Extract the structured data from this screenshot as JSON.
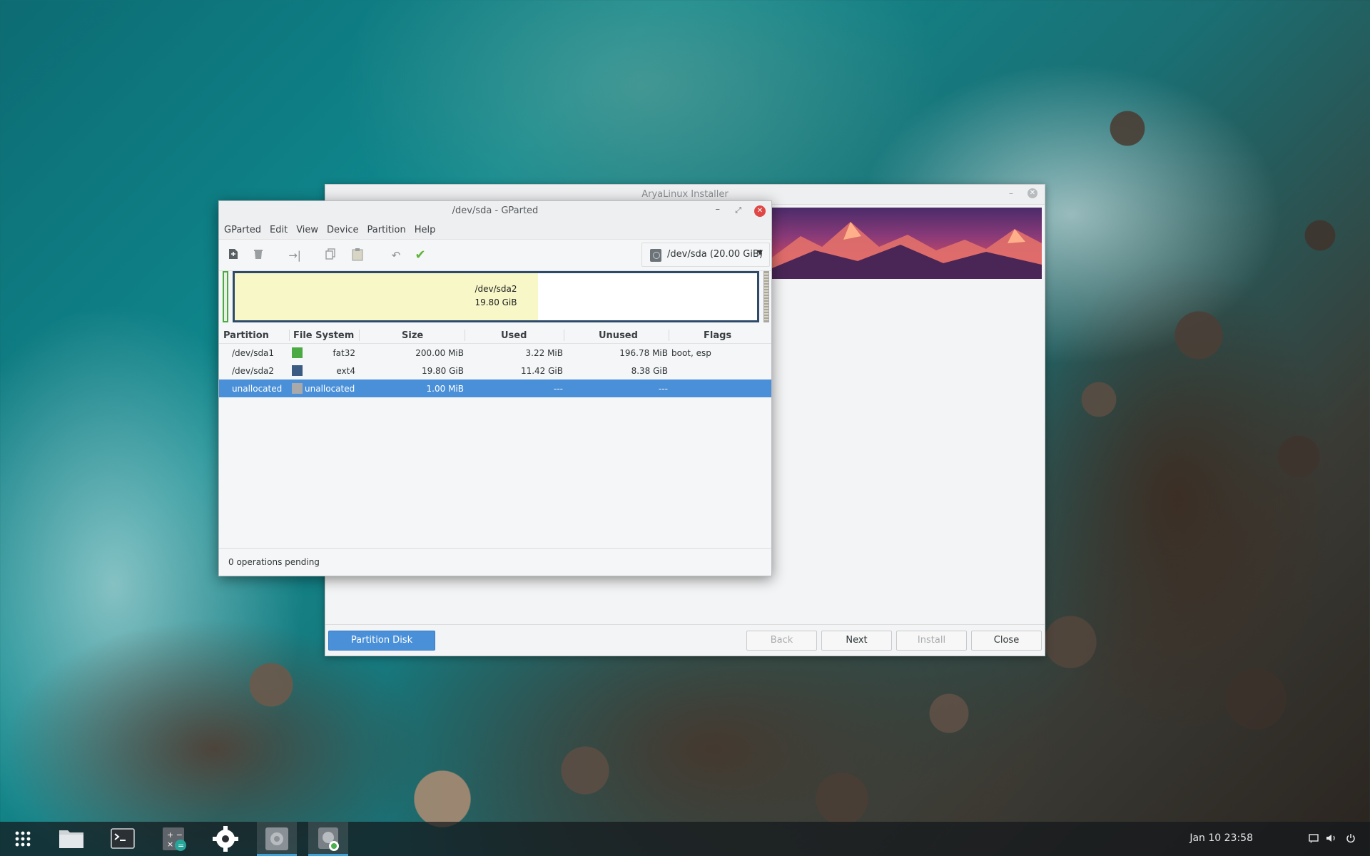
{
  "installer": {
    "title": "AryaLinux Installer",
    "buttons": {
      "partition_disk": "Partition Disk",
      "back": "Back",
      "next": "Next",
      "install": "Install",
      "close": "Close"
    }
  },
  "gparted": {
    "title": "/dev/sda - GParted",
    "menu": [
      "GParted",
      "Edit",
      "View",
      "Device",
      "Partition",
      "Help"
    ],
    "device_selector": "/dev/sda (20.00 GiB)",
    "disk_map": {
      "partition": "/dev/sda2",
      "size": "19.80 GiB",
      "used_fraction": 0.58
    },
    "columns": [
      "Partition",
      "File System",
      "Size",
      "Used",
      "Unused",
      "Flags"
    ],
    "rows": [
      {
        "partition": "/dev/sda1",
        "fs_color": "#4caa45",
        "filesystem": "fat32",
        "size": "200.00 MiB",
        "used": "3.22 MiB",
        "unused": "196.78 MiB",
        "flags": "boot, esp",
        "selected": false
      },
      {
        "partition": "/dev/sda2",
        "fs_color": "#3b5a84",
        "filesystem": "ext4",
        "size": "19.80 GiB",
        "used": "11.42 GiB",
        "unused": "8.38 GiB",
        "flags": "",
        "selected": false
      },
      {
        "partition": "unallocated",
        "fs_color": "#a9a9a9",
        "filesystem": "unallocated",
        "size": "1.00 MiB",
        "used": "---",
        "unused": "---",
        "flags": "",
        "selected": true
      }
    ],
    "status": "0 operations pending"
  },
  "taskbar": {
    "clock": "Jan 10  23:58",
    "apps": [
      "app-grid-icon",
      "files-icon",
      "terminal-icon",
      "calculator-icon",
      "settings-icon",
      "installer-icon",
      "gparted-icon"
    ]
  },
  "colors": {
    "accent": "#4a90d9",
    "close_red": "#e04848",
    "apply_green": "#5fb33b"
  }
}
